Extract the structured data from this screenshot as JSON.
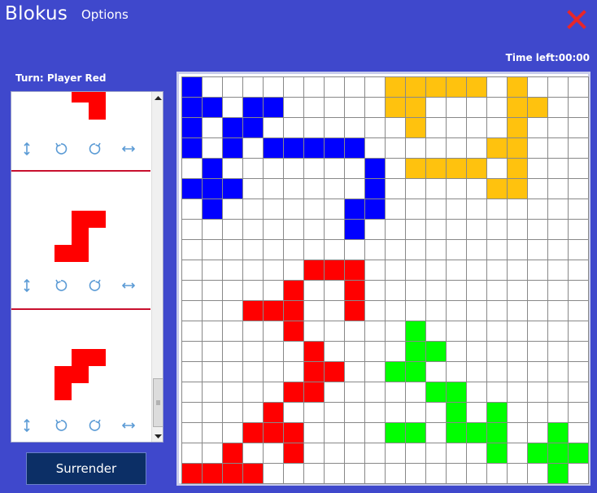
{
  "app": {
    "title": "Blokus",
    "menu_options": "Options"
  },
  "status": {
    "turn": "Turn: Player Red",
    "time_left": "Time left:00:00"
  },
  "buttons": {
    "surrender": "Surrender"
  },
  "icons": {
    "close": "close-icon",
    "flip_vertical": "flip-vertical-icon",
    "rotate_left": "rotate-left-icon",
    "rotate_right": "rotate-right-icon",
    "flip_horizontal": "flip-horizontal-icon"
  },
  "colors": {
    "background": "#3f48cc",
    "blue": "#0000ff",
    "yellow": "#ffc20e",
    "red": "#ff0000",
    "green": "#00ff00",
    "close": "#e8262a",
    "tool_icon": "#5b9bd5"
  },
  "pieces": [
    {
      "name": "piece-1",
      "cells": [
        [
          0,
          0
        ],
        [
          0,
          1
        ],
        [
          1,
          1
        ]
      ]
    },
    {
      "name": "piece-2",
      "cells": [
        [
          0,
          1
        ],
        [
          0,
          2
        ],
        [
          1,
          1
        ],
        [
          2,
          0
        ],
        [
          2,
          1
        ]
      ]
    },
    {
      "name": "piece-3",
      "cells": [
        [
          0,
          1
        ],
        [
          0,
          2
        ],
        [
          1,
          0
        ],
        [
          1,
          1
        ],
        [
          2,
          0
        ]
      ]
    }
  ],
  "board": {
    "size": 20,
    "rows": [
      "B.........YYYYY.Y...",
      "BB.BB.....YY....YY..",
      "B.BB.......Y....Y...",
      "B.B.BBBBB......YY...",
      ".B.......B.YYYY.Y...",
      "BBB......B.....YY...",
      ".B......BB..........",
      "........B...........",
      "....................",
      "......RRR...........",
      ".....R..R...........",
      "...RRR..R...........",
      ".....R.....G........",
      "......R....GG.......",
      "......RR..GG........",
      ".....RR.....GG......",
      "....R........G.G....",
      "...RRR....GG.GGG..G.",
      "..R..R.........G.GGG",
      "RRRR..............G."
    ]
  }
}
